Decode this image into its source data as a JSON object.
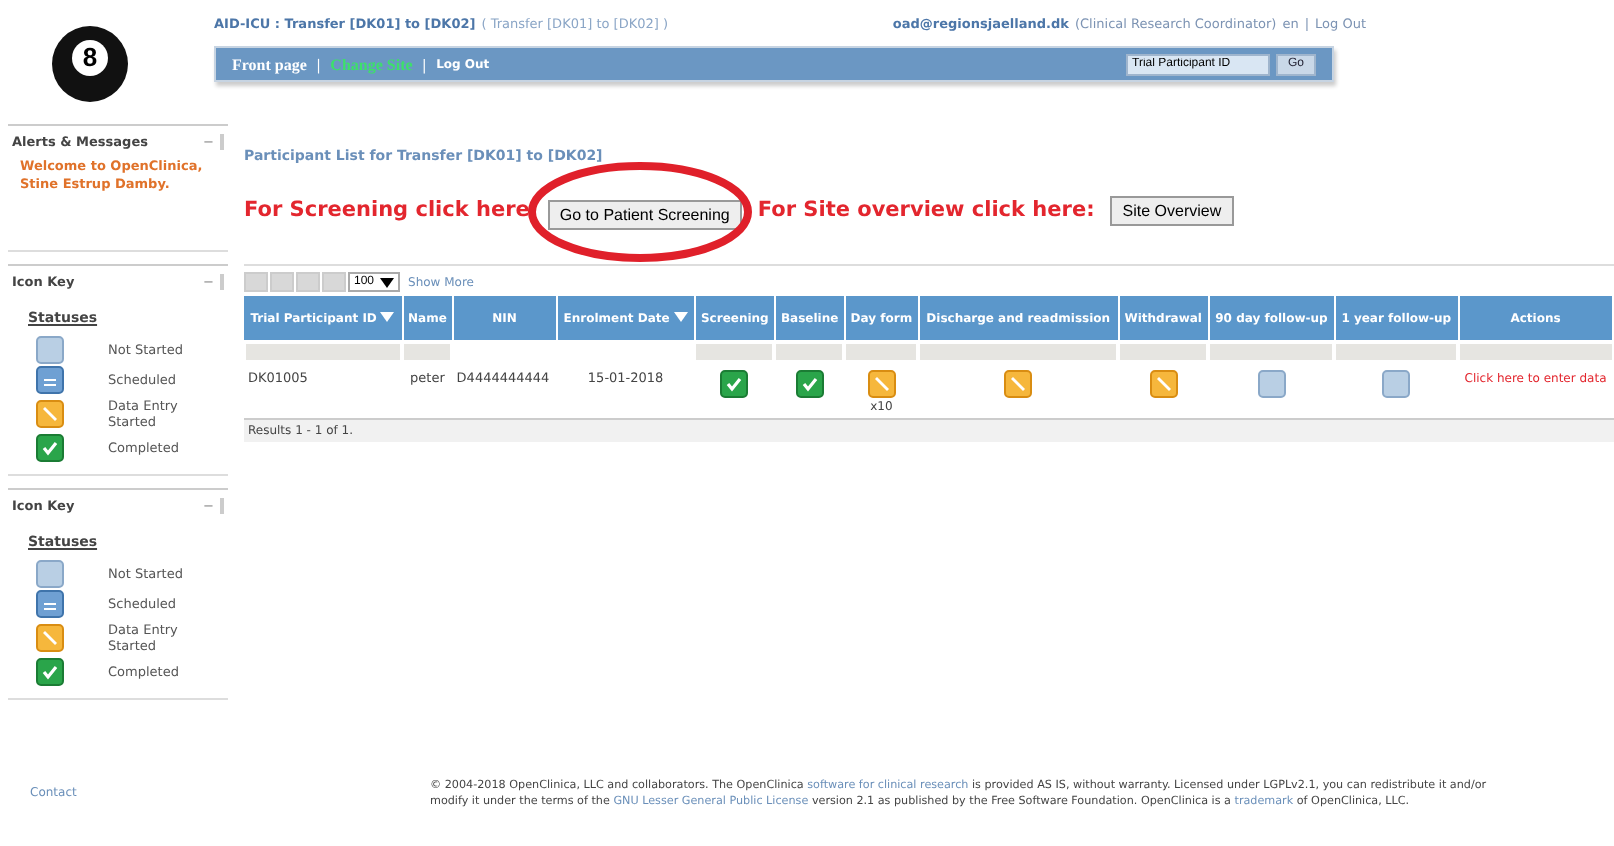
{
  "logo": {
    "label": "8"
  },
  "header": {
    "study": "AID-ICU : Transfer [DK01] to [DK02]",
    "study_sub": "( Transfer [DK01] to [DK02] )",
    "user": "oad@regionsjaelland.dk",
    "role": "(Clinical Research Coordinator)",
    "lang": "en",
    "separator": "|",
    "logout": "Log Out"
  },
  "nav": {
    "items": [
      {
        "label": "Front page",
        "kind": "bold"
      },
      {
        "label": "|",
        "kind": "sep"
      },
      {
        "label": "Change Site",
        "kind": "green"
      },
      {
        "label": "|",
        "kind": "sep"
      },
      {
        "label": "Log Out",
        "kind": "small"
      }
    ],
    "search": {
      "placeholder": "Trial Participant ID"
    },
    "go": "Go"
  },
  "sidebar": {
    "panels": [
      {
        "title": "Alerts & Messages",
        "collapse": "−",
        "kind": "message",
        "text": "Welcome to OpenClinica, Stine Estrup Damby."
      },
      {
        "title": "Icon Key",
        "collapse": "−",
        "kind": "key",
        "heading": "Statuses",
        "items": [
          {
            "kind": "not_started",
            "label": "Not Started"
          },
          {
            "kind": "scheduled",
            "label": "Scheduled"
          },
          {
            "kind": "data_entry",
            "label": "Data Entry Started"
          },
          {
            "kind": "completed",
            "label": "Completed"
          }
        ]
      },
      {
        "title": "Icon Key",
        "collapse": "−",
        "kind": "key",
        "heading": "Statuses",
        "items": [
          {
            "kind": "not_started",
            "label": "Not Started"
          },
          {
            "kind": "scheduled",
            "label": "Scheduled"
          },
          {
            "kind": "data_entry",
            "label": "Data Entry Started"
          },
          {
            "kind": "completed",
            "label": "Completed"
          }
        ]
      }
    ]
  },
  "page_title": "Participant List for Transfer [DK01] to [DK02]",
  "screening": {
    "prompt": "For Screening click here",
    "button": "Go to Patient Screening",
    "circled": true
  },
  "site": {
    "prompt": "For Site overview click here:",
    "button": "Site Overview"
  },
  "pager": {
    "page_size": "100",
    "show_more": "Show More"
  },
  "table": {
    "columns": [
      {
        "label": "Trial Participant ID",
        "sort": true,
        "filter": true
      },
      {
        "label": "Name",
        "sort": false,
        "filter": true
      },
      {
        "label": "NIN",
        "sort": false,
        "filter": false
      },
      {
        "label": "Enrolment Date",
        "sort": true,
        "filter": false
      },
      {
        "label": "Screening",
        "sort": false,
        "filter": true
      },
      {
        "label": "Baseline",
        "sort": false,
        "filter": true
      },
      {
        "label": "Day form",
        "sort": false,
        "filter": true
      },
      {
        "label": "Discharge and readmission",
        "sort": false,
        "filter": true
      },
      {
        "label": "Withdrawal",
        "sort": false,
        "filter": true
      },
      {
        "label": "90 day follow-up",
        "sort": false,
        "filter": true
      },
      {
        "label": "1 year follow-up",
        "sort": false,
        "filter": true
      },
      {
        "label": "Actions",
        "sort": false,
        "filter": true
      }
    ],
    "rows": [
      {
        "id": "DK01005",
        "name": "peter",
        "nin": "D4444444444",
        "date": "15-01-2018",
        "events": [
          {
            "kind": "completed"
          },
          {
            "kind": "completed"
          },
          {
            "kind": "data_entry",
            "count": "x10"
          },
          {
            "kind": "data_entry"
          },
          {
            "kind": "data_entry"
          },
          {
            "kind": "not_started"
          },
          {
            "kind": "not_started"
          }
        ],
        "action": "Click here to enter data"
      }
    ],
    "results": "Results 1 - 1 of 1."
  },
  "footer": {
    "contact": "Contact",
    "parts": [
      {
        "kind": "plain",
        "text": "© 2004-2018 OpenClinica, LLC and collaborators. The OpenClinica"
      },
      {
        "kind": "link",
        "text": "software for clinical research"
      },
      {
        "kind": "plain",
        "text": "is provided AS IS, without warranty. Licensed under LGPLv2.1, you can redistribute it and/or modify it under the terms of the"
      },
      {
        "kind": "link",
        "text": "GNU Lesser General Public License"
      },
      {
        "kind": "plain",
        "text": "version 2.1 as published by the Free Software Foundation. OpenClinica is a"
      },
      {
        "kind": "link",
        "text": "trademark"
      },
      {
        "kind": "plain",
        "text": "of OpenClinica, LLC."
      }
    ]
  }
}
